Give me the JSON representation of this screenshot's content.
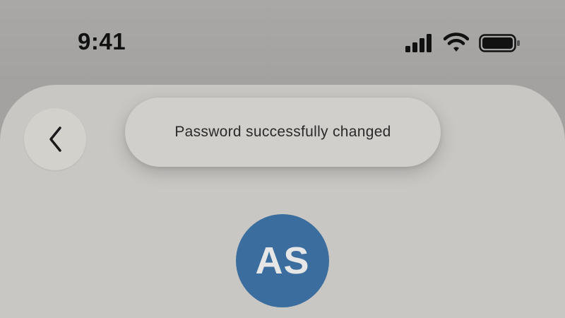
{
  "status_bar": {
    "time": "9:41",
    "icons": [
      "cellular-signal-icon",
      "wifi-icon",
      "battery-icon"
    ]
  },
  "navigation": {
    "back_icon": "chevron-left-icon"
  },
  "toast": {
    "message": "Password successfully changed"
  },
  "profile": {
    "initials": "AS",
    "avatar_color": "#3b6e9e"
  },
  "colors": {
    "background": "#a9a8a6",
    "sheet": "#c8c7c4",
    "toast": "#d0cfcc",
    "back_button": "#d3d1cc"
  }
}
